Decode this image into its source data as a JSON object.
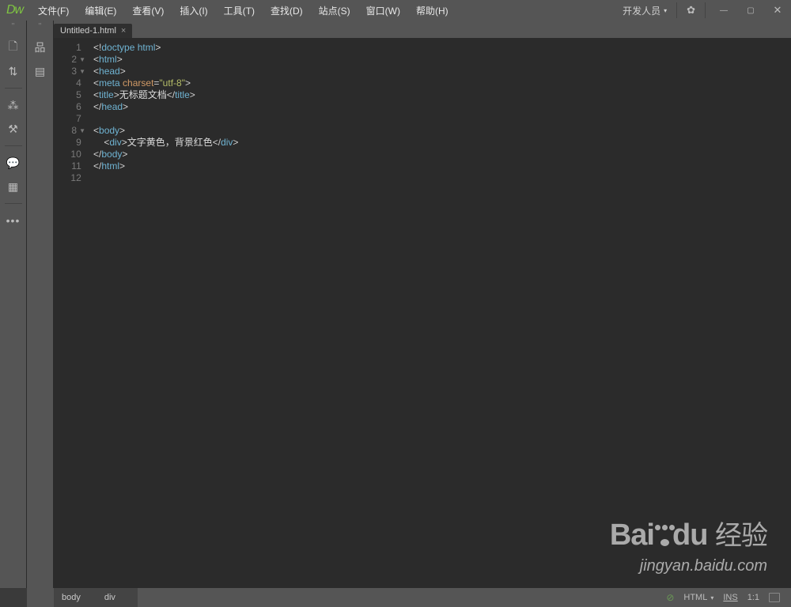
{
  "titlebar": {
    "logo": "Dw",
    "menus": [
      "文件(F)",
      "编辑(E)",
      "查看(V)",
      "插入(I)",
      "工具(T)",
      "查找(D)",
      "站点(S)",
      "窗口(W)",
      "帮助(H)"
    ],
    "workspace": "开发人员"
  },
  "tabs": {
    "active": "Untitled-1.html"
  },
  "code": {
    "lines": [
      {
        "n": "1",
        "fold": "",
        "tokens": [
          {
            "c": "t-punc",
            "t": "<!"
          },
          {
            "c": "t-doctype",
            "t": "doctype html"
          },
          {
            "c": "t-punc",
            "t": ">"
          }
        ]
      },
      {
        "n": "2",
        "fold": "▼",
        "tokens": [
          {
            "c": "t-punc",
            "t": "<"
          },
          {
            "c": "t-tag",
            "t": "html"
          },
          {
            "c": "t-punc",
            "t": ">"
          }
        ]
      },
      {
        "n": "3",
        "fold": "▼",
        "tokens": [
          {
            "c": "t-punc",
            "t": "<"
          },
          {
            "c": "t-tag",
            "t": "head"
          },
          {
            "c": "t-punc",
            "t": ">"
          }
        ]
      },
      {
        "n": "4",
        "fold": "",
        "tokens": [
          {
            "c": "t-punc",
            "t": "<"
          },
          {
            "c": "t-tag",
            "t": "meta"
          },
          {
            "c": "t-text",
            "t": " "
          },
          {
            "c": "t-attr",
            "t": "charset"
          },
          {
            "c": "t-punc",
            "t": "="
          },
          {
            "c": "t-string",
            "t": "\"utf-8\""
          },
          {
            "c": "t-punc",
            "t": ">"
          }
        ]
      },
      {
        "n": "5",
        "fold": "",
        "tokens": [
          {
            "c": "t-punc",
            "t": "<"
          },
          {
            "c": "t-tag",
            "t": "title"
          },
          {
            "c": "t-punc",
            "t": ">"
          },
          {
            "c": "t-text",
            "t": "无标题文档"
          },
          {
            "c": "t-punc",
            "t": "</"
          },
          {
            "c": "t-tag",
            "t": "title"
          },
          {
            "c": "t-punc",
            "t": ">"
          }
        ]
      },
      {
        "n": "6",
        "fold": "",
        "tokens": [
          {
            "c": "t-punc",
            "t": "</"
          },
          {
            "c": "t-tag",
            "t": "head"
          },
          {
            "c": "t-punc",
            "t": ">"
          }
        ]
      },
      {
        "n": "7",
        "fold": "",
        "tokens": []
      },
      {
        "n": "8",
        "fold": "▼",
        "tokens": [
          {
            "c": "t-punc",
            "t": "<"
          },
          {
            "c": "t-tag",
            "t": "body"
          },
          {
            "c": "t-punc",
            "t": ">"
          }
        ]
      },
      {
        "n": "9",
        "fold": "",
        "tokens": [
          {
            "c": "t-text",
            "t": "    "
          },
          {
            "c": "t-punc",
            "t": "<"
          },
          {
            "c": "t-tag",
            "t": "div"
          },
          {
            "c": "t-punc",
            "t": ">"
          },
          {
            "c": "t-text",
            "t": "文字黄色，背景红色"
          },
          {
            "c": "t-punc",
            "t": "</"
          },
          {
            "c": "t-tag",
            "t": "div"
          },
          {
            "c": "t-punc",
            "t": ">"
          }
        ]
      },
      {
        "n": "10",
        "fold": "",
        "tokens": [
          {
            "c": "t-punc",
            "t": "</"
          },
          {
            "c": "t-tag",
            "t": "body"
          },
          {
            "c": "t-punc",
            "t": ">"
          }
        ]
      },
      {
        "n": "11",
        "fold": "",
        "tokens": [
          {
            "c": "t-punc",
            "t": "</"
          },
          {
            "c": "t-tag",
            "t": "html"
          },
          {
            "c": "t-punc",
            "t": ">"
          }
        ]
      },
      {
        "n": "12",
        "fold": "",
        "tokens": []
      }
    ]
  },
  "status": {
    "breadcrumbs": [
      "body",
      "div"
    ],
    "lang": "HTML",
    "mode": "INS",
    "pos": "1:1"
  },
  "watermark": {
    "brand": "Bai",
    "du": "du",
    "cn": "经验",
    "sub": "jingyan.baidu.com"
  }
}
